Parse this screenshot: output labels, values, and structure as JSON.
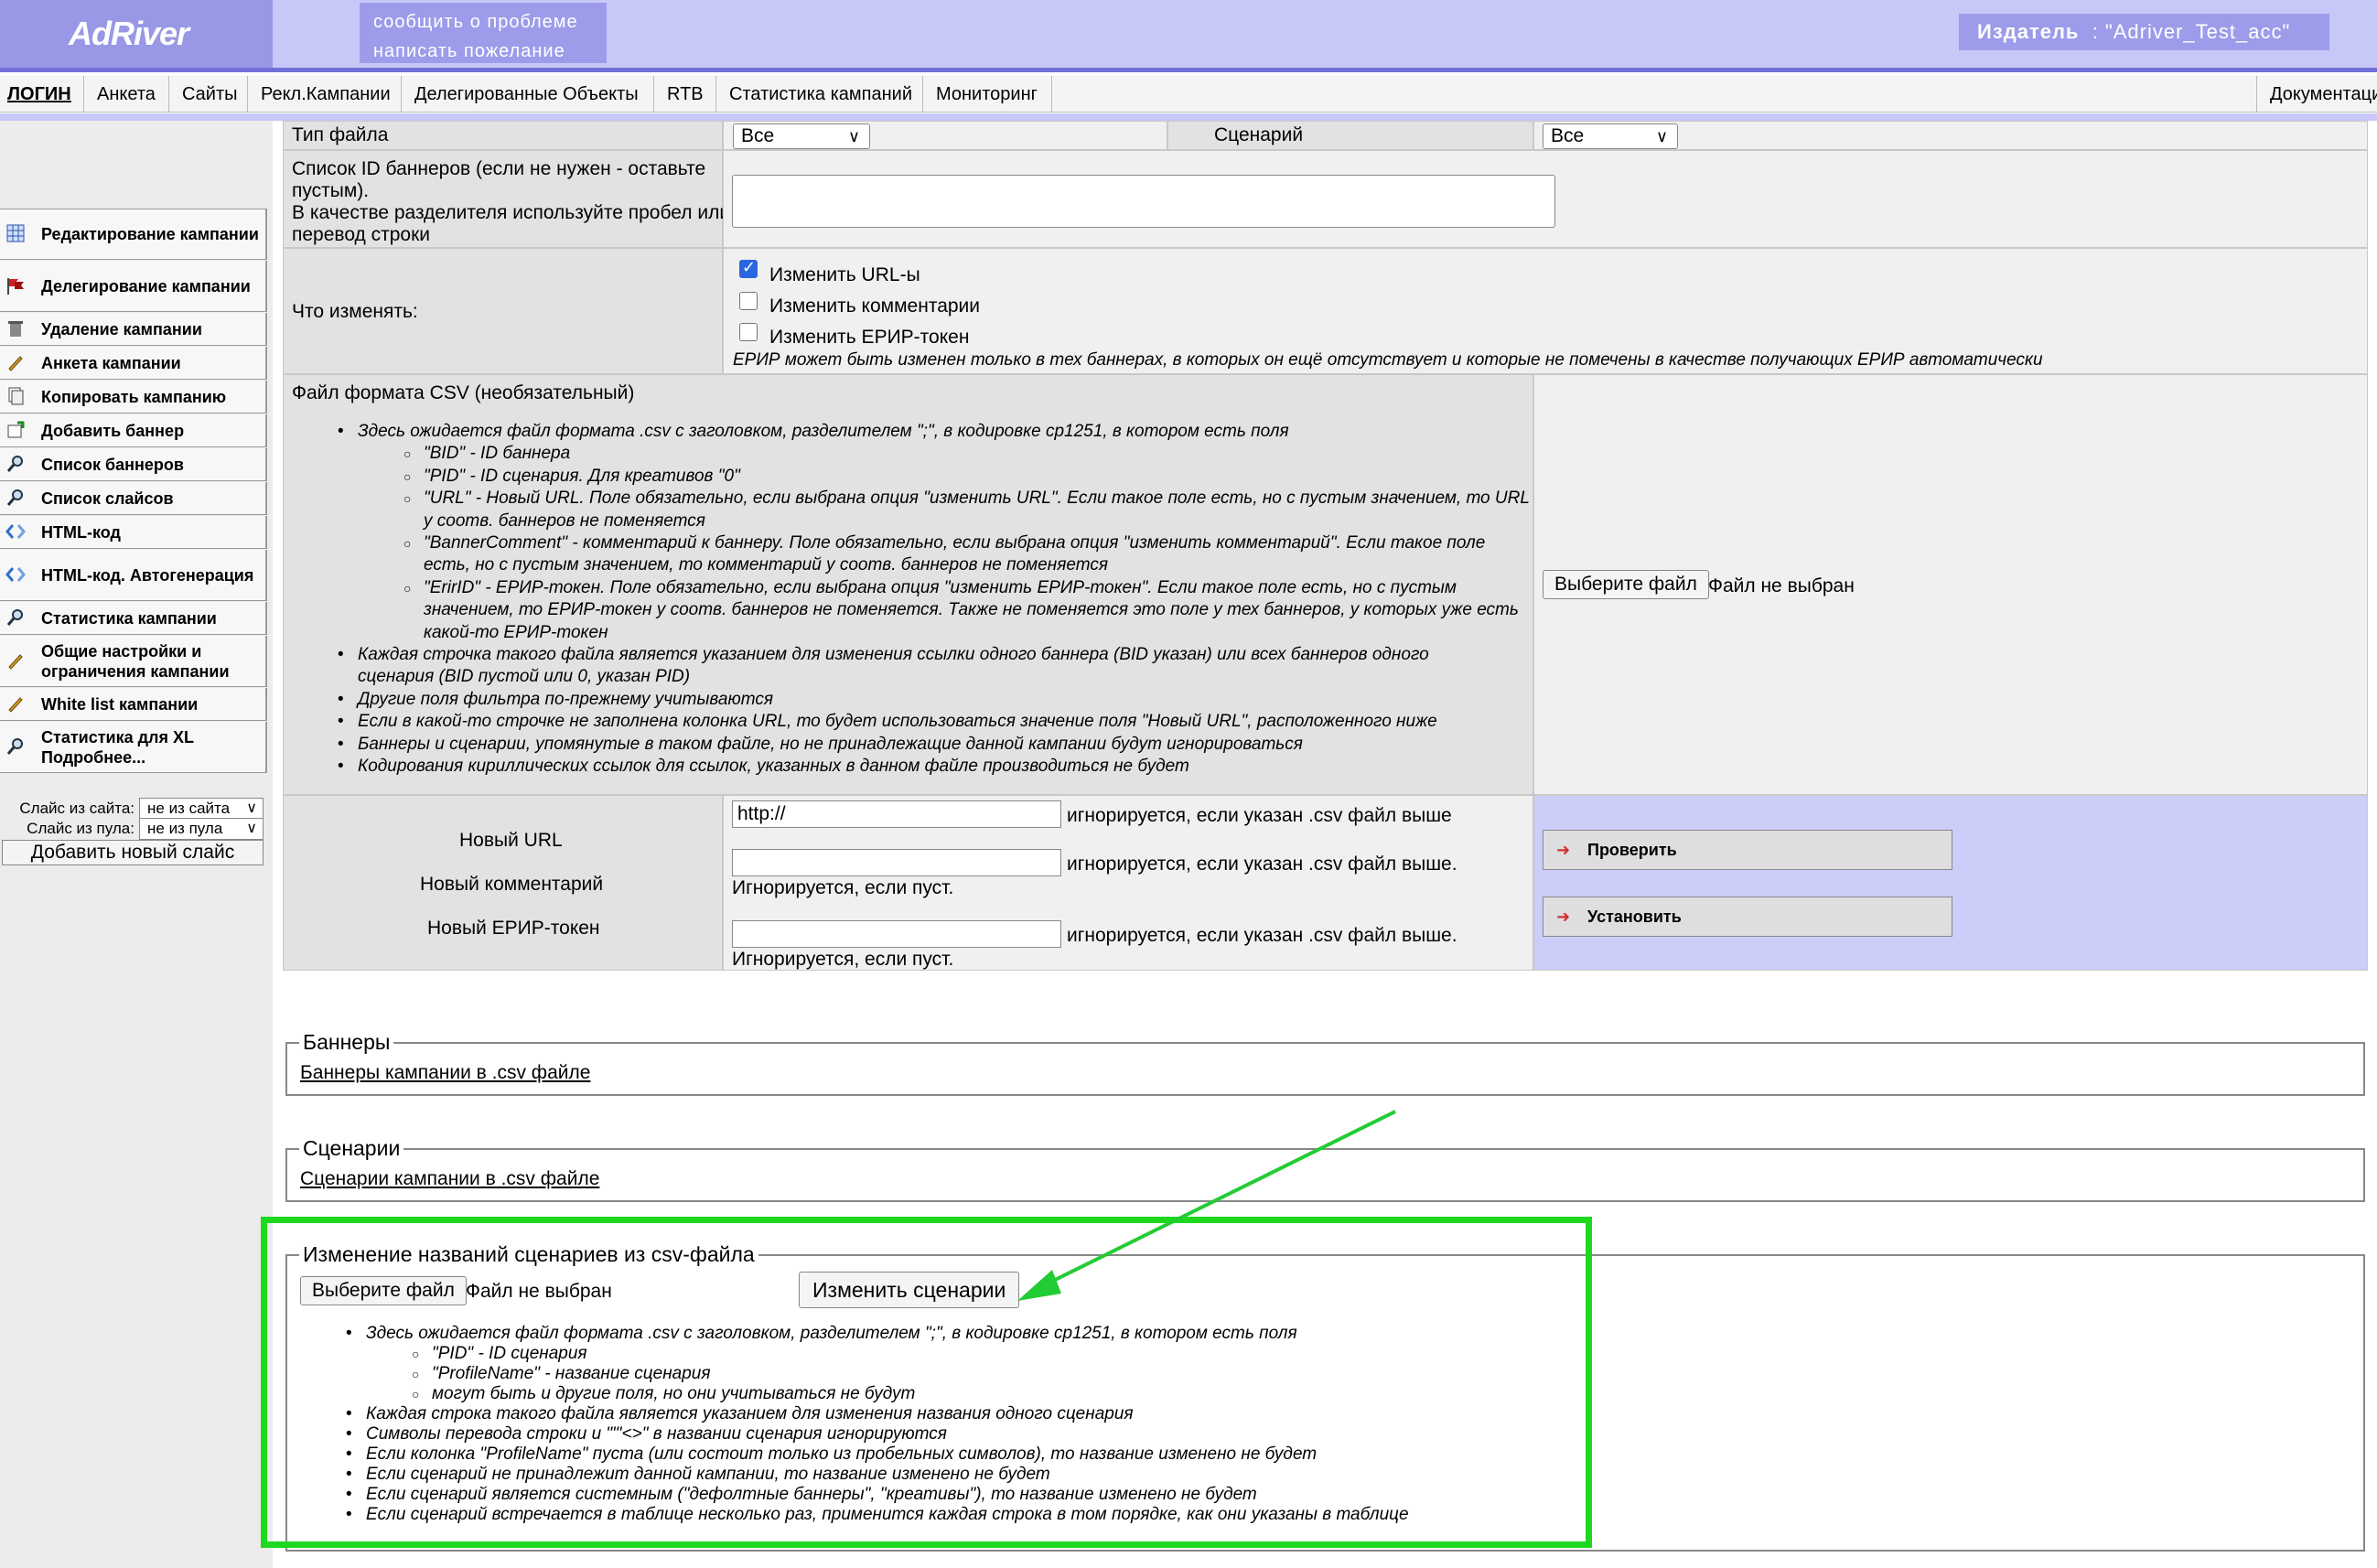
{
  "header": {
    "logo": "AdRiver",
    "report_problem": "сообщить о проблеме",
    "write_wish": "написать пожелание",
    "publisher_label": "Издатель",
    "publisher_value": ": \"Adriver_Test_acc\""
  },
  "topmenu": {
    "items": [
      "ЛОГИН",
      "Анкета",
      "Сайты",
      "Рекл.Кампании",
      "Делегированные Объекты",
      "RTB",
      "Статистика кампаний",
      "Мониторинг"
    ],
    "docs": "Документаци"
  },
  "sidebar": {
    "items": [
      {
        "label": "Редактирование кампании",
        "icon": "grid-icon"
      },
      {
        "label": "Делегирование кампании",
        "icon": "flags-icon"
      },
      {
        "label": "Удаление кампании",
        "icon": "trash-icon"
      },
      {
        "label": "Анкета кампании",
        "icon": "pencil-icon"
      },
      {
        "label": "Копировать кампанию",
        "icon": "copy-icon"
      },
      {
        "label": "Добавить баннер",
        "icon": "add-banner-icon"
      },
      {
        "label": "Список баннеров",
        "icon": "magnifier-icon"
      },
      {
        "label": "Список слайсов",
        "icon": "magnifier-icon"
      },
      {
        "label": "HTML-код",
        "icon": "code-icon"
      },
      {
        "label": "HTML-код. Автогенерация",
        "icon": "code-icon"
      },
      {
        "label": "Статистика кампании",
        "icon": "magnifier-icon"
      },
      {
        "label": "Общие настройки и ограничения кампании",
        "icon": "pencil-icon"
      },
      {
        "label": "White list кампании",
        "icon": "pencil-icon"
      },
      {
        "label": "Статистика для XL Подробнее...",
        "icon": "magnifier-icon"
      }
    ],
    "slice_site_label": "Слайс из сайта:",
    "slice_site_value": "не из сайта",
    "slice_pool_label": "Слайс из пула:",
    "slice_pool_value": "не из пула",
    "add_slice": "Добавить новый слайс"
  },
  "form": {
    "file_type_label": "Тип файла",
    "file_type_value": "Все",
    "scenario_label": "Сценарий",
    "scenario_value": "Все",
    "banner_ids_label_1": "Список ID баннеров (если не нужен - оставьте",
    "banner_ids_label_2": "пустым).",
    "banner_ids_label_3": "В качестве разделителя используйте пробел или",
    "banner_ids_label_4": "перевод строки",
    "what_change_label": "Что изменять:",
    "change_urls": "Изменить URL-ы",
    "change_comments": "Изменить комментарии",
    "change_erir": "Изменить ЕРИР-токен",
    "erir_note": "ЕРИР может быть изменен только в тех баннерах, в которых он ещё отсутствует и которые не помечены в качестве получающих ЕРИР автоматически",
    "csv_label": "Файл формата CSV (необязательный)",
    "csv_help": [
      {
        "level": 1,
        "text": "Здесь ожидается файл формата .csv с заголовком, разделителем \";\", в кодировке cp1251, в котором есть поля"
      },
      {
        "level": 2,
        "text": "\"BID\" - ID баннера"
      },
      {
        "level": 2,
        "text": "\"PID\" - ID сценария. Для креативов \"0\""
      },
      {
        "level": 2,
        "text": "\"URL\" - Новый URL. Поле обязательно, если выбрана опция \"изменить URL\". Если такое поле есть, но с пустым значением, то URL"
      },
      {
        "level": 0,
        "text": "у соотв. баннеров не поменяется"
      },
      {
        "level": 2,
        "text": "\"BannerComment\" - комментарий к баннеру. Поле обязательно, если выбрана опция \"изменить комментарий\". Если такое поле"
      },
      {
        "level": 0,
        "text": "есть, но с пустым значением, то комментарий у соотв. баннеров не поменяется"
      },
      {
        "level": 2,
        "text": "\"ErirID\" - ЕРИР-токен. Поле обязательно, если выбрана опция \"изменить ЕРИР-токен\". Если такое поле есть, но с пустым"
      },
      {
        "level": 0,
        "text": "значением, то ЕРИР-токен у соотв. баннеров не поменяется. Также не поменяется это поле у тех баннеров, у которых уже есть"
      },
      {
        "level": 0,
        "text": "какой-то ЕРИР-токен"
      },
      {
        "level": 1,
        "text": "Каждая строчка такого файла является указанием для изменения ссылки одного баннера (BID указан) или всех баннеров одного"
      },
      {
        "level": 0,
        "text": "сценария (BID пустой или 0, указан PID)"
      },
      {
        "level": 1,
        "text": "Другие поля фильтра по-прежнему учитываются"
      },
      {
        "level": 1,
        "text": "Если в какой-то строчке не заполнена колонка URL, то будет использоваться значение поля \"Новый URL\", расположенного ниже"
      },
      {
        "level": 1,
        "text": "Баннеры и сценарии, упомянутые в таком файле, но не принадлежащие данной кампании будут игнорироваться"
      },
      {
        "level": 1,
        "text": "Кодирования кириллических ссылок для ссылок, указанных в данном файле производиться не будет"
      }
    ],
    "choose_file": "Выберите файл",
    "no_file": "Файл не выбран",
    "new_url_label": "Новый URL",
    "new_url_value": "http://",
    "new_url_note": "игнорируется, если указан .csv файл выше",
    "new_comment_label": "Новый комментарий",
    "new_comment_note": "игнорируется, если указан .csv файл выше.",
    "ignored_if_empty": "Игнорируется, если пуст.",
    "new_erir_label": "Новый ЕРИР-токен",
    "new_erir_note": "игнорируется, если указан .csv файл выше.",
    "check_button": "Проверить",
    "install_button": "Установить"
  },
  "banners_section": {
    "legend": "Баннеры",
    "link": "Баннеры кампании в .csv файле"
  },
  "scenarios_section": {
    "legend": "Сценарии",
    "link": "Сценарии кампании в .csv файле"
  },
  "rename_section": {
    "legend": "Изменение названий сценариев из csv-файла",
    "choose_file": "Выберите файл",
    "no_file": "Файл не выбран",
    "change_button": "Изменить сценарии",
    "help": [
      {
        "level": 1,
        "text": "Здесь ожидается файл формата .csv с заголовком, разделителем \";\", в кодировке cp1251, в котором есть поля"
      },
      {
        "level": 2,
        "text": "\"PID\" - ID сценария"
      },
      {
        "level": 2,
        "text": "\"ProfileName\" - название сценария"
      },
      {
        "level": 2,
        "text": "могут быть и другие поля, но они учитываться не будут"
      },
      {
        "level": 1,
        "text": "Каждая строка такого файла является указанием для изменения названия одного сценария"
      },
      {
        "level": 1,
        "text": "Символы перевода строки и \"\"'<>\" в названии сценария игнорируются"
      },
      {
        "level": 1,
        "text": "Если колонка \"ProfileName\" пуста (или состоит только из пробельных символов), то название изменено не будет"
      },
      {
        "level": 1,
        "text": "Если сценарий не принадлежит данной кампании, то название изменено не будет"
      },
      {
        "level": 1,
        "text": "Если сценарий является системным (\"дефолтные баннеры\", \"креативы\"), то название изменено не будет"
      },
      {
        "level": 1,
        "text": "Если сценарий встречается в таблице несколько раз, применится каждая строка в том порядке, как они указаны в таблице"
      }
    ]
  },
  "colors": {
    "header_bg": "#c8c8f8",
    "logo_bg": "#9898e6",
    "highlight_box": "#1ed81e",
    "annotation_arrow": "#22cc33"
  }
}
